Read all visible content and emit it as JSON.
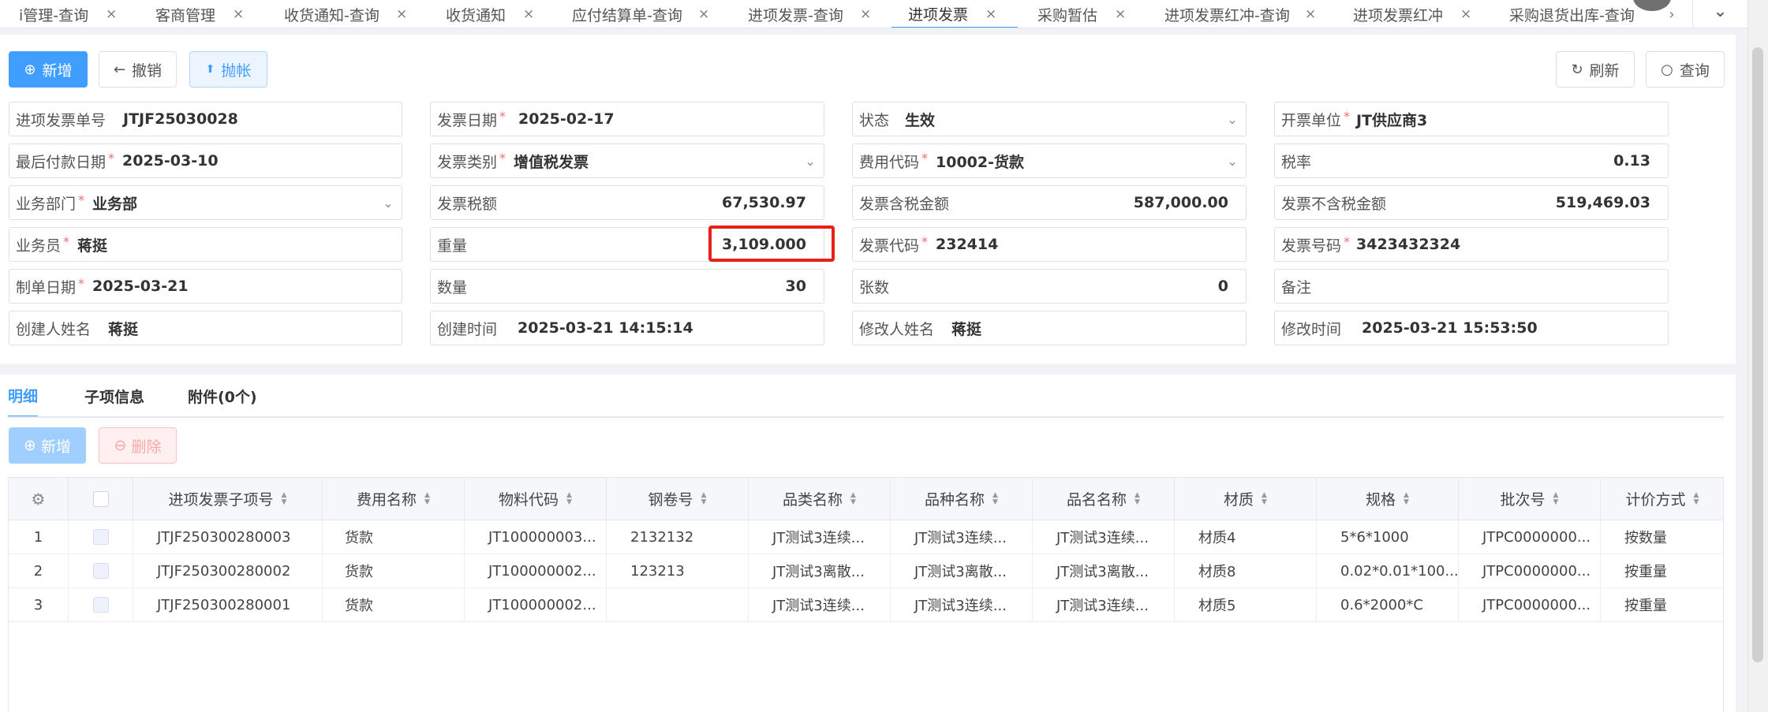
{
  "tabs": [
    {
      "label": "i管理-查询",
      "active": false
    },
    {
      "label": "客商管理",
      "active": false
    },
    {
      "label": "收货通知-查询",
      "active": false
    },
    {
      "label": "收货通知",
      "active": false
    },
    {
      "label": "应付结算单-查询",
      "active": false
    },
    {
      "label": "进项发票-查询",
      "active": false
    },
    {
      "label": "进项发票",
      "active": true
    },
    {
      "label": "采购暂估",
      "active": false
    },
    {
      "label": "进项发票红冲-查询",
      "active": false
    },
    {
      "label": "进项发票红冲",
      "active": false
    },
    {
      "label": "采购退货出库-查询",
      "active": false
    }
  ],
  "tab_close_glyph": "×",
  "tab_scroll_glyph": "›",
  "tab_dropdown_glyph": "⌄",
  "toolbar": {
    "add_label": "新增",
    "revoke_label": "撤销",
    "post_label": "抛帐",
    "refresh_label": "刷新",
    "query_label": "查询"
  },
  "icons": {
    "add": "⊕",
    "back": "←",
    "post": "⬆",
    "refresh": "↻",
    "search": "○",
    "dropdown": "⌄",
    "delete": "⊖",
    "gear": "⚙",
    "sort_up": "▲",
    "sort_down": "▼"
  },
  "form": {
    "invoice_no": {
      "label": "进项发票单号",
      "value": "JTJF25030028"
    },
    "invoice_date": {
      "label": "发票日期",
      "value": "2025-02-17"
    },
    "status": {
      "label": "状态",
      "value": "生效"
    },
    "issuer": {
      "label": "开票单位",
      "value": "JT供应商3"
    },
    "last_pay_date": {
      "label": "最后付款日期",
      "value": "2025-03-10"
    },
    "invoice_type": {
      "label": "发票类别",
      "value": "增值税发票"
    },
    "fee_code": {
      "label": "费用代码",
      "value": "10002-货款"
    },
    "tax_rate": {
      "label": "税率",
      "value": "0.13"
    },
    "dept": {
      "label": "业务部门",
      "value": "业务部"
    },
    "invoice_tax": {
      "label": "发票税额",
      "value": "67,530.97"
    },
    "amount_incl_tax": {
      "label": "发票含税金额",
      "value": "587,000.00"
    },
    "amount_excl_tax": {
      "label": "发票不含税金额",
      "value": "519,469.03"
    },
    "salesman": {
      "label": "业务员",
      "value": "蒋挺"
    },
    "weight": {
      "label": "重量",
      "value": "3,109.000"
    },
    "invoice_code": {
      "label": "发票代码",
      "value": "232414"
    },
    "invoice_number": {
      "label": "发票号码",
      "value": "3423432324"
    },
    "create_date": {
      "label": "制单日期",
      "value": "2025-03-21"
    },
    "quantity": {
      "label": "数量",
      "value": "30"
    },
    "sheets": {
      "label": "张数",
      "value": "0"
    },
    "remark": {
      "label": "备注",
      "value": ""
    },
    "creator": {
      "label": "创建人姓名",
      "value": "蒋挺"
    },
    "create_time": {
      "label": "创建时间",
      "value": "2025-03-21 14:15:14"
    },
    "modifier": {
      "label": "修改人姓名",
      "value": "蒋挺"
    },
    "modify_time": {
      "label": "修改时间",
      "value": "2025-03-21 15:53:50"
    }
  },
  "subtabs": [
    {
      "label": "明细",
      "active": true
    },
    {
      "label": "子项信息",
      "active": false
    },
    {
      "label": "附件(0个)",
      "active": false
    }
  ],
  "detail_toolbar": {
    "add_label": "新增",
    "delete_label": "删除"
  },
  "table": {
    "columns": [
      "进项发票子项号",
      "费用名称",
      "物料代码",
      "钢卷号",
      "品类名称",
      "品种名称",
      "品名名称",
      "材质",
      "规格",
      "批次号",
      "计价方式"
    ],
    "rows": [
      [
        "1",
        "JTJF250300280003",
        "货款",
        "JT100000003...",
        "2132132",
        "JT测试3连续...",
        "JT测试3连续...",
        "JT测试3连续...",
        "材质4",
        "5*6*1000",
        "JTPC0000000...",
        "按数量"
      ],
      [
        "2",
        "JTJF250300280002",
        "货款",
        "JT100000002...",
        "123213",
        "JT测试3离散...",
        "JT测试3离散...",
        "JT测试3离散...",
        "材质8",
        "0.02*0.01*100...",
        "JTPC0000000...",
        "按重量"
      ],
      [
        "3",
        "JTJF250300280001",
        "货款",
        "JT100000002...",
        "",
        "JT测试3连续...",
        "JT测试3连续...",
        "JT测试3连续...",
        "材质5",
        "0.6*2000*C",
        "JTPC0000000...",
        "按重量"
      ]
    ]
  }
}
